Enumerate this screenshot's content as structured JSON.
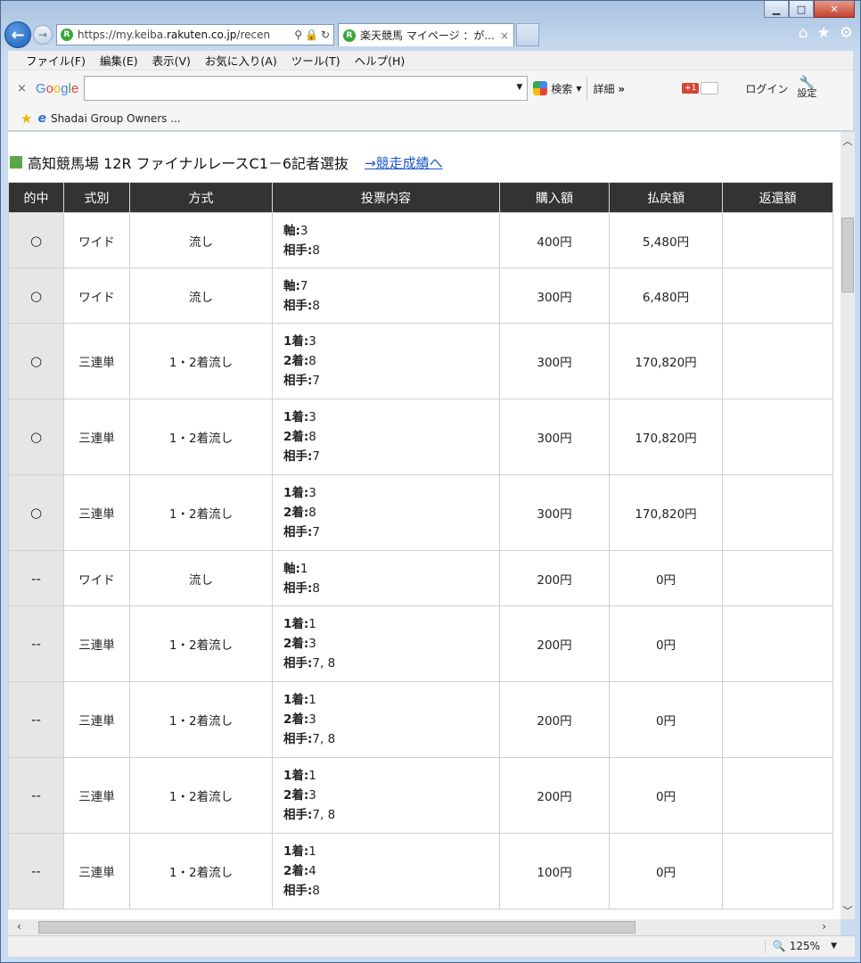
{
  "browser": {
    "url_prefix": "https://my.keiba.",
    "url_domain": "rakuten.co.jp",
    "url_path": "/recen",
    "tab_title": "楽天競馬 マイページ ：が...",
    "tab_close": "×",
    "menu": [
      "ファイル(F)",
      "編集(E)",
      "表示(V)",
      "お気に入り(A)",
      "ツール(T)",
      "ヘルプ(H)"
    ],
    "google": {
      "close": "×",
      "logo": "Google",
      "search_label": "検索",
      "detail_label": "詳細",
      "more": "»",
      "plus_one": "+1",
      "login_label": "ログイン",
      "settings_label": "設定"
    },
    "favorites": [
      {
        "label": "Shadai Group Owners ..."
      }
    ],
    "zoom": "125%"
  },
  "race": {
    "title": "高知競馬場 12R ファイナルレースC1－6記者選抜",
    "link": "→競走成績へ"
  },
  "table": {
    "headers": [
      "的中",
      "式別",
      "方式",
      "投票内容",
      "購入額",
      "払戻額",
      "返還額"
    ],
    "rows": [
      {
        "hit": "○",
        "type": "ワイド",
        "method": "流し",
        "lines": [
          [
            "軸:",
            "3"
          ],
          [
            "相手:",
            "8"
          ]
        ],
        "bet": "400円",
        "payout": "5,480円",
        "refund": ""
      },
      {
        "hit": "○",
        "type": "ワイド",
        "method": "流し",
        "lines": [
          [
            "軸:",
            "7"
          ],
          [
            "相手:",
            "8"
          ]
        ],
        "bet": "300円",
        "payout": "6,480円",
        "refund": ""
      },
      {
        "hit": "○",
        "type": "三連単",
        "method": "1・2着流し",
        "lines": [
          [
            "1着:",
            "3"
          ],
          [
            "2着:",
            "8"
          ],
          [
            "相手:",
            "7"
          ]
        ],
        "bet": "300円",
        "payout": "170,820円",
        "refund": ""
      },
      {
        "hit": "○",
        "type": "三連単",
        "method": "1・2着流し",
        "lines": [
          [
            "1着:",
            "3"
          ],
          [
            "2着:",
            "8"
          ],
          [
            "相手:",
            "7"
          ]
        ],
        "bet": "300円",
        "payout": "170,820円",
        "refund": ""
      },
      {
        "hit": "○",
        "type": "三連単",
        "method": "1・2着流し",
        "lines": [
          [
            "1着:",
            "3"
          ],
          [
            "2着:",
            "8"
          ],
          [
            "相手:",
            "7"
          ]
        ],
        "bet": "300円",
        "payout": "170,820円",
        "refund": ""
      },
      {
        "hit": "--",
        "type": "ワイド",
        "method": "流し",
        "lines": [
          [
            "軸:",
            "1"
          ],
          [
            "相手:",
            "8"
          ]
        ],
        "bet": "200円",
        "payout": "0円",
        "refund": ""
      },
      {
        "hit": "--",
        "type": "三連単",
        "method": "1・2着流し",
        "lines": [
          [
            "1着:",
            "1"
          ],
          [
            "2着:",
            "3"
          ],
          [
            "相手:",
            "7, 8"
          ]
        ],
        "bet": "200円",
        "payout": "0円",
        "refund": ""
      },
      {
        "hit": "--",
        "type": "三連単",
        "method": "1・2着流し",
        "lines": [
          [
            "1着:",
            "1"
          ],
          [
            "2着:",
            "3"
          ],
          [
            "相手:",
            "7, 8"
          ]
        ],
        "bet": "200円",
        "payout": "0円",
        "refund": ""
      },
      {
        "hit": "--",
        "type": "三連単",
        "method": "1・2着流し",
        "lines": [
          [
            "1着:",
            "1"
          ],
          [
            "2着:",
            "3"
          ],
          [
            "相手:",
            "7, 8"
          ]
        ],
        "bet": "200円",
        "payout": "0円",
        "refund": ""
      },
      {
        "hit": "--",
        "type": "三連単",
        "method": "1・2着流し",
        "lines": [
          [
            "1着:",
            "1"
          ],
          [
            "2着:",
            "4"
          ],
          [
            "相手:",
            "8"
          ]
        ],
        "bet": "100円",
        "payout": "0円",
        "refund": ""
      }
    ]
  }
}
